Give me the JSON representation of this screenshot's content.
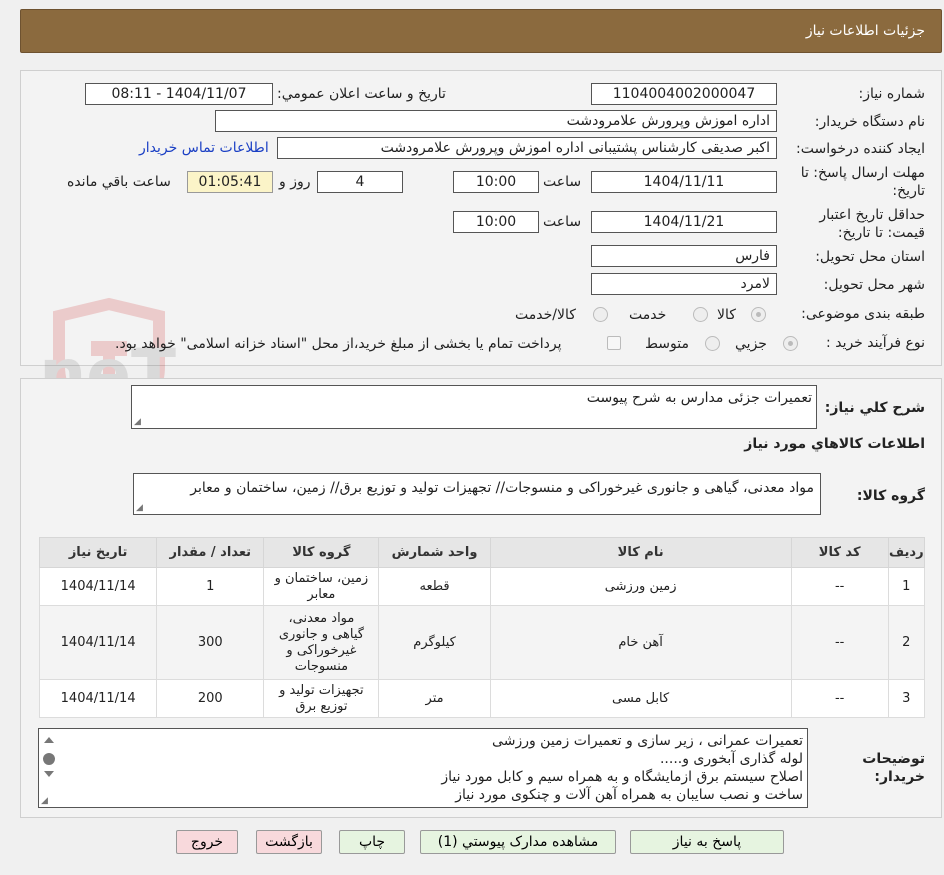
{
  "header": {
    "title": "جزئیات اطلاعات نیاز"
  },
  "form": {
    "need_number_label": "شماره نیاز:",
    "need_number": "1104004002000047",
    "announce_label": "تاریخ و ساعت اعلان عمومي:",
    "announce_value": "1404/11/07 - 08:11",
    "buyer_org_label": "نام دستگاه خريدار:",
    "buyer_org": "اداره اموزش وپرورش علامرودشت",
    "requester_label": "ايجاد کننده درخواست:",
    "requester": "اکبر صدیقی کارشناس پشتیبانی اداره اموزش وپرورش علامرودشت",
    "contact_link": "اطلاعات تماس خريدار",
    "deadline_label_1": "مهلت ارسال پاسخ: تا",
    "deadline_label_2": "تاريخ:",
    "deadline_date": "1404/11/11",
    "time_label": "ساعت",
    "deadline_time": "10:00",
    "days_value": "4",
    "days_label": "روز و",
    "remaining_time": "01:05:41",
    "remaining_label": "ساعت باقي مانده",
    "validity_label_1": "حداقل تاريخ اعتبار",
    "validity_label_2": "قيمت: تا تاريخ:",
    "validity_date": "1404/11/21",
    "validity_time": "10:00",
    "province_label": "استان محل تحويل:",
    "province": "فارس",
    "city_label": "شهر محل تحويل:",
    "city": "لامرد",
    "category_label": "طبقه بندی موضوعی:",
    "category_options": [
      "کالا",
      "خدمت",
      "کالا/خدمت"
    ],
    "process_label": "نوع فرآيند خريد :",
    "process_options": [
      "جزیي",
      "متوسط"
    ],
    "treasury_note": "پرداخت تمام يا بخشی از مبلغ خريد،از محل \"اسناد خزانه اسلامی\" خواهد بود."
  },
  "description": {
    "label": "شرح کلي نياز:",
    "text": "تعمیرات جزئی مدارس به شرح پیوست"
  },
  "goods": {
    "section_title": "اطلاعات کالاهاي مورد نياز",
    "group_label": "گروه کالا:",
    "group_text": "مواد معدنی، گیاهی و جانوری غیرخوراکی و منسوجات// تجهیزات تولید و توزیع برق// زمین، ساختمان و معابر",
    "columns": [
      "رديف",
      "کد کالا",
      "نام کالا",
      "واحد شمارش",
      "گروه کالا",
      "تعداد / مقدار",
      "تاريخ نياز"
    ],
    "rows": [
      {
        "row": "1",
        "code": "--",
        "name": "زمین ورزشی",
        "unit": "قطعه",
        "group_lines": [
          "زمین، ساختمان و",
          "معابر"
        ],
        "qty": "1",
        "date": "1404/11/14"
      },
      {
        "row": "2",
        "code": "--",
        "name": "آهن خام",
        "unit": "کیلوگرم",
        "group_lines": [
          "مواد معدنی،",
          "گیاهی و جانوری",
          "غیرخوراکی و",
          "منسوجات"
        ],
        "qty": "300",
        "date": "1404/11/14"
      },
      {
        "row": "3",
        "code": "--",
        "name": "کابل مسی",
        "unit": "متر",
        "group_lines": [
          "تجهیزات تولید و",
          "توزیع برق"
        ],
        "qty": "200",
        "date": "1404/11/14"
      }
    ]
  },
  "buyer_notes": {
    "label_1": "توضيحات",
    "label_2": "خريدار:",
    "lines": [
      "تعمیرات عمرانی ، زیر سازی و تعمیرات زمین ورزشی",
      "لوله گذاری آبخوری و.....",
      "اصلاح سیستم برق ازمایشگاه و به همراه سیم و کابل مورد نیاز",
      "ساخت و نصب سایبان به همراه آهن آلات و چنکوی مورد نیاز"
    ]
  },
  "buttons": {
    "reply": "پاسخ به نياز",
    "attachments": "مشاهده مدارک پيوستي (1)",
    "print": "چاپ",
    "back": "بازگشت",
    "exit": "خروج"
  },
  "watermark": {
    "text": "AriaTender.neT"
  },
  "colors": {
    "header": "#8b6a3e",
    "link": "#1a3fc4",
    "remaining_bg": "#fbf4c8",
    "green_button": "#e6f4e0",
    "pink_button": "#f8d9dc"
  }
}
